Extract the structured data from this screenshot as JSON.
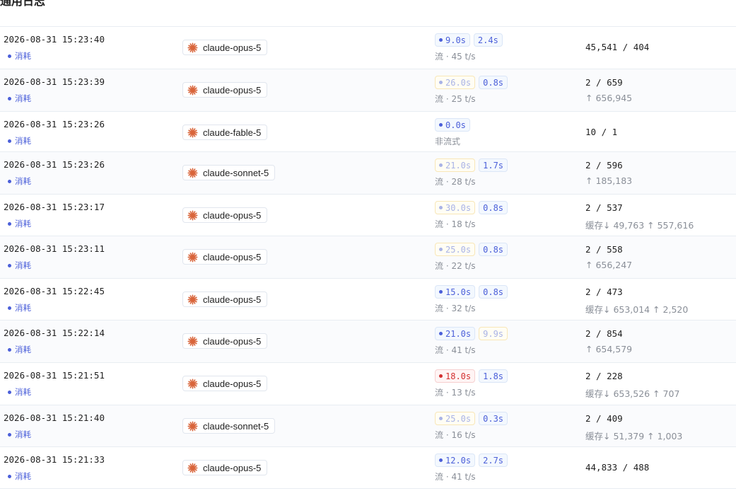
{
  "page": {
    "title": "通用日志"
  },
  "colors": {
    "accent": "#4b5fd9",
    "error": "#d32f2f",
    "muted": "#8a8f98",
    "claude_orange": "#d9653b"
  },
  "rows": [
    {
      "time": "2026-08-31 15:23:40",
      "type": "消耗",
      "model": "claude-opus-5",
      "total": "9.0s",
      "total_style": "ok",
      "first": "2.4s",
      "first_style": "ok",
      "stream": "流 · 45 t/s",
      "tokens": "45,541 / 404",
      "sub": ""
    },
    {
      "time": "2026-08-31 15:23:39",
      "type": "消耗",
      "model": "claude-opus-5",
      "total": "26.0s",
      "total_style": "warn",
      "first": "0.8s",
      "first_style": "ok",
      "stream": "流 · 25 t/s",
      "tokens": "2 / 659",
      "sub": "↑ 656,945"
    },
    {
      "time": "2026-08-31 15:23:26",
      "type": "消耗",
      "model": "claude-fable-5",
      "total": "0.0s",
      "total_style": "ok",
      "first": "",
      "first_style": "",
      "stream": "非流式",
      "tokens": "10 / 1",
      "sub": ""
    },
    {
      "time": "2026-08-31 15:23:26",
      "type": "消耗",
      "model": "claude-sonnet-5",
      "total": "21.0s",
      "total_style": "warn",
      "first": "1.7s",
      "first_style": "ok",
      "stream": "流 · 28 t/s",
      "tokens": "2 / 596",
      "sub": "↑ 185,183"
    },
    {
      "time": "2026-08-31 15:23:17",
      "type": "消耗",
      "model": "claude-opus-5",
      "total": "30.0s",
      "total_style": "warn",
      "first": "0.8s",
      "first_style": "ok",
      "stream": "流 · 18 t/s",
      "tokens": "2 / 537",
      "sub": "缓存↓ 49,763 ↑ 557,616"
    },
    {
      "time": "2026-08-31 15:23:11",
      "type": "消耗",
      "model": "claude-opus-5",
      "total": "25.0s",
      "total_style": "warn",
      "first": "0.8s",
      "first_style": "ok",
      "stream": "流 · 22 t/s",
      "tokens": "2 / 558",
      "sub": "↑ 656,247"
    },
    {
      "time": "2026-08-31 15:22:45",
      "type": "消耗",
      "model": "claude-opus-5",
      "total": "15.0s",
      "total_style": "ok",
      "first": "0.8s",
      "first_style": "ok",
      "stream": "流 · 32 t/s",
      "tokens": "2 / 473",
      "sub": "缓存↓ 653,014 ↑ 2,520"
    },
    {
      "time": "2026-08-31 15:22:14",
      "type": "消耗",
      "model": "claude-opus-5",
      "total": "21.0s",
      "total_style": "ok",
      "first": "9.9s",
      "first_style": "warn",
      "stream": "流 · 41 t/s",
      "tokens": "2 / 854",
      "sub": "↑ 654,579"
    },
    {
      "time": "2026-08-31 15:21:51",
      "type": "消耗",
      "model": "claude-opus-5",
      "total": "18.0s",
      "total_style": "err",
      "first": "1.8s",
      "first_style": "ok",
      "stream": "流 · 13 t/s",
      "tokens": "2 / 228",
      "sub": "缓存↓ 653,526 ↑ 707"
    },
    {
      "time": "2026-08-31 15:21:40",
      "type": "消耗",
      "model": "claude-sonnet-5",
      "total": "25.0s",
      "total_style": "warn",
      "first": "0.3s",
      "first_style": "ok",
      "stream": "流 · 16 t/s",
      "tokens": "2 / 409",
      "sub": "缓存↓ 51,379 ↑ 1,003"
    },
    {
      "time": "2026-08-31 15:21:33",
      "type": "消耗",
      "model": "claude-opus-5",
      "total": "12.0s",
      "total_style": "ok",
      "first": "2.7s",
      "first_style": "ok",
      "stream": "流 · 41 t/s",
      "tokens": "44,833 / 488",
      "sub": ""
    }
  ]
}
